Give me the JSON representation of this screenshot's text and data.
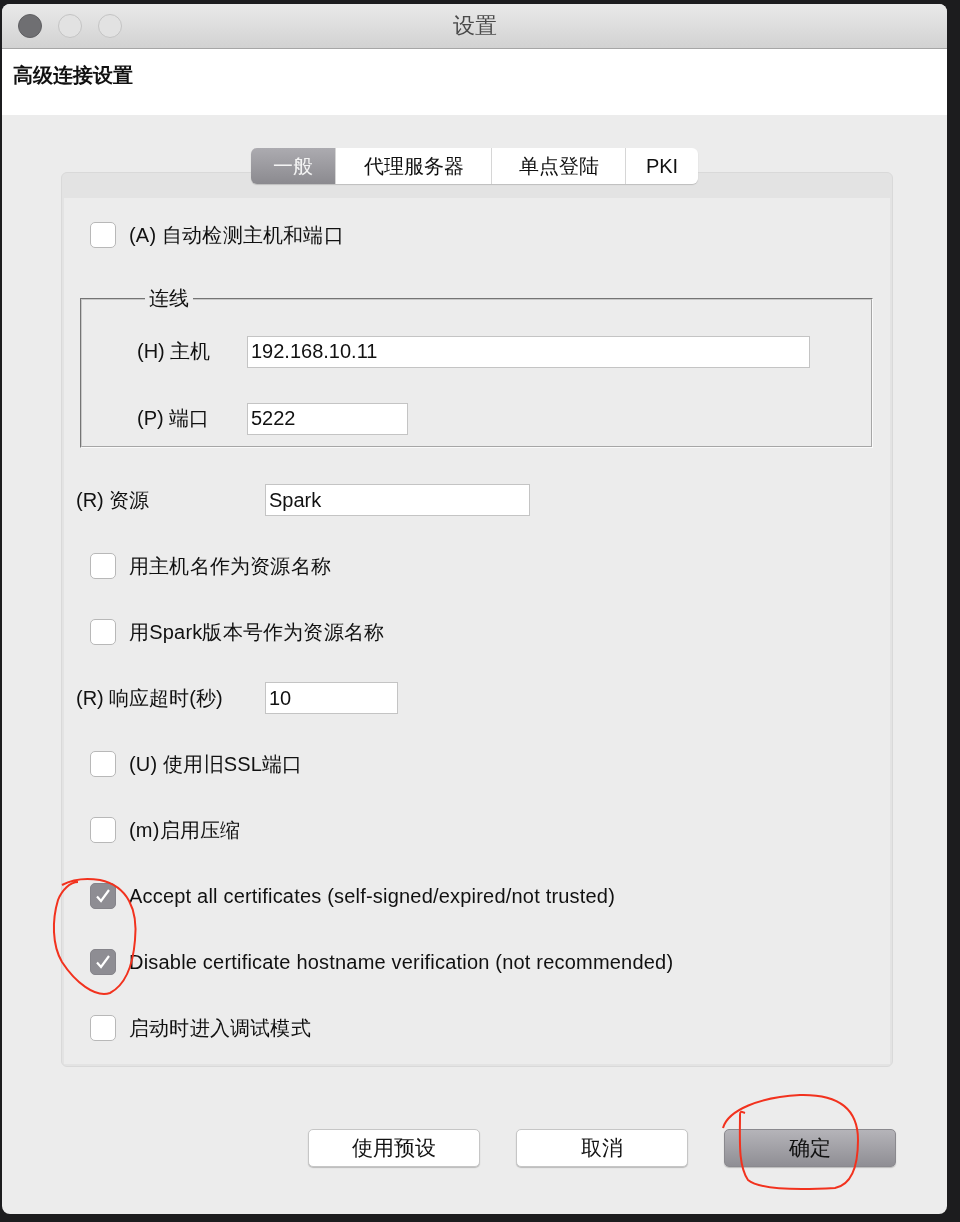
{
  "window": {
    "title": "设置"
  },
  "header": {
    "title": "高级连接设置"
  },
  "tabs": [
    {
      "label": "一般",
      "selected": true
    },
    {
      "label": "代理服务器",
      "selected": false
    },
    {
      "label": "单点登陆",
      "selected": false
    },
    {
      "label": "PKI",
      "selected": false
    }
  ],
  "settings": [
    {
      "kind": "checkbox",
      "label": "(A) 自动检测主机和端口",
      "checked": false
    },
    {
      "kind": "group",
      "title": "连线",
      "fields": [
        {
          "label": "(H) 主机",
          "value": "192.168.10.11"
        },
        {
          "label": "(P) 端口",
          "value": "5222"
        }
      ]
    },
    {
      "kind": "field",
      "label": "(R) 资源",
      "value": "Spark"
    },
    {
      "kind": "checkbox",
      "label": "用主机名作为资源名称",
      "checked": false
    },
    {
      "kind": "checkbox",
      "label": "用Spark版本号作为资源名称",
      "checked": false
    },
    {
      "kind": "field",
      "label": "(R) 响应超时(秒)",
      "value": "10"
    },
    {
      "kind": "checkbox",
      "label": "(U) 使用旧SSL端口",
      "checked": false
    },
    {
      "kind": "checkbox",
      "label": "(m)启用压缩",
      "checked": false
    },
    {
      "kind": "checkbox",
      "label": "Accept all certificates (self-signed/expired/not trusted)",
      "checked": true
    },
    {
      "kind": "checkbox",
      "label": "Disable certificate hostname verification (not recommended)",
      "checked": true
    },
    {
      "kind": "checkbox",
      "label": "启动时进入调试模式",
      "checked": false
    }
  ],
  "buttons": [
    {
      "label": "使用预设",
      "default": false
    },
    {
      "label": "取消",
      "default": false
    },
    {
      "label": "确定",
      "default": true
    }
  ]
}
